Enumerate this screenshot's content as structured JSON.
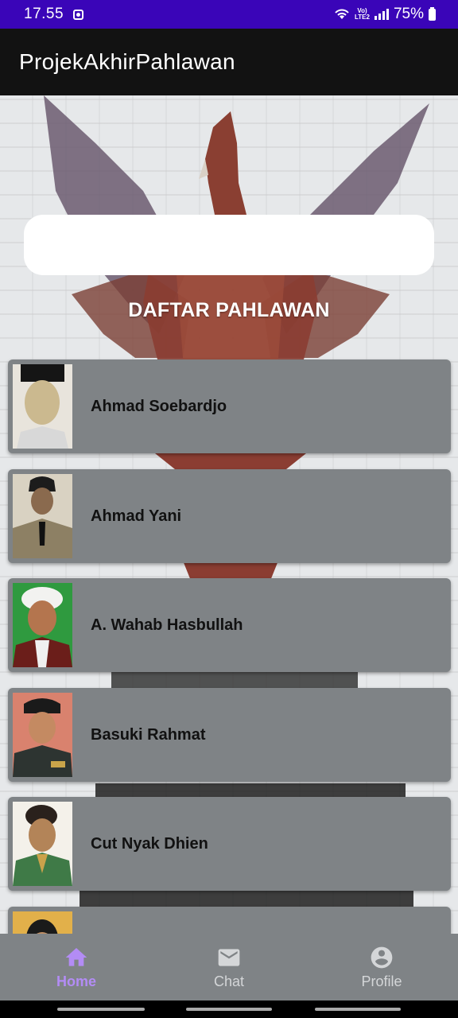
{
  "status_bar": {
    "time": "17.55",
    "network_label_top": "Vo)",
    "network_label_bottom": "LTE2",
    "battery": "75%"
  },
  "app_bar": {
    "title": "ProjekAkhirPahlawan"
  },
  "search": {
    "placeholder": "",
    "value": ""
  },
  "list": {
    "title": "DAFTAR PAHLAWAN",
    "items": [
      {
        "name": "Ahmad Soebardjo"
      },
      {
        "name": "Ahmad Yani"
      },
      {
        "name": "A. Wahab Hasbullah"
      },
      {
        "name": "Basuki Rahmat"
      },
      {
        "name": "Cut Nyak Dhien"
      },
      {
        "name": ""
      }
    ]
  },
  "bottom_nav": {
    "items": [
      {
        "label": "Home",
        "icon": "home-icon",
        "active": true
      },
      {
        "label": "Chat",
        "icon": "mail-icon",
        "active": false
      },
      {
        "label": "Profile",
        "icon": "account-circle-icon",
        "active": false
      }
    ]
  },
  "colors": {
    "status_bar": "#3a05b8",
    "app_bar": "#121212",
    "card": "#7f8386",
    "nav_active": "#b38cf5",
    "nav_inactive": "#d4d6d8"
  }
}
